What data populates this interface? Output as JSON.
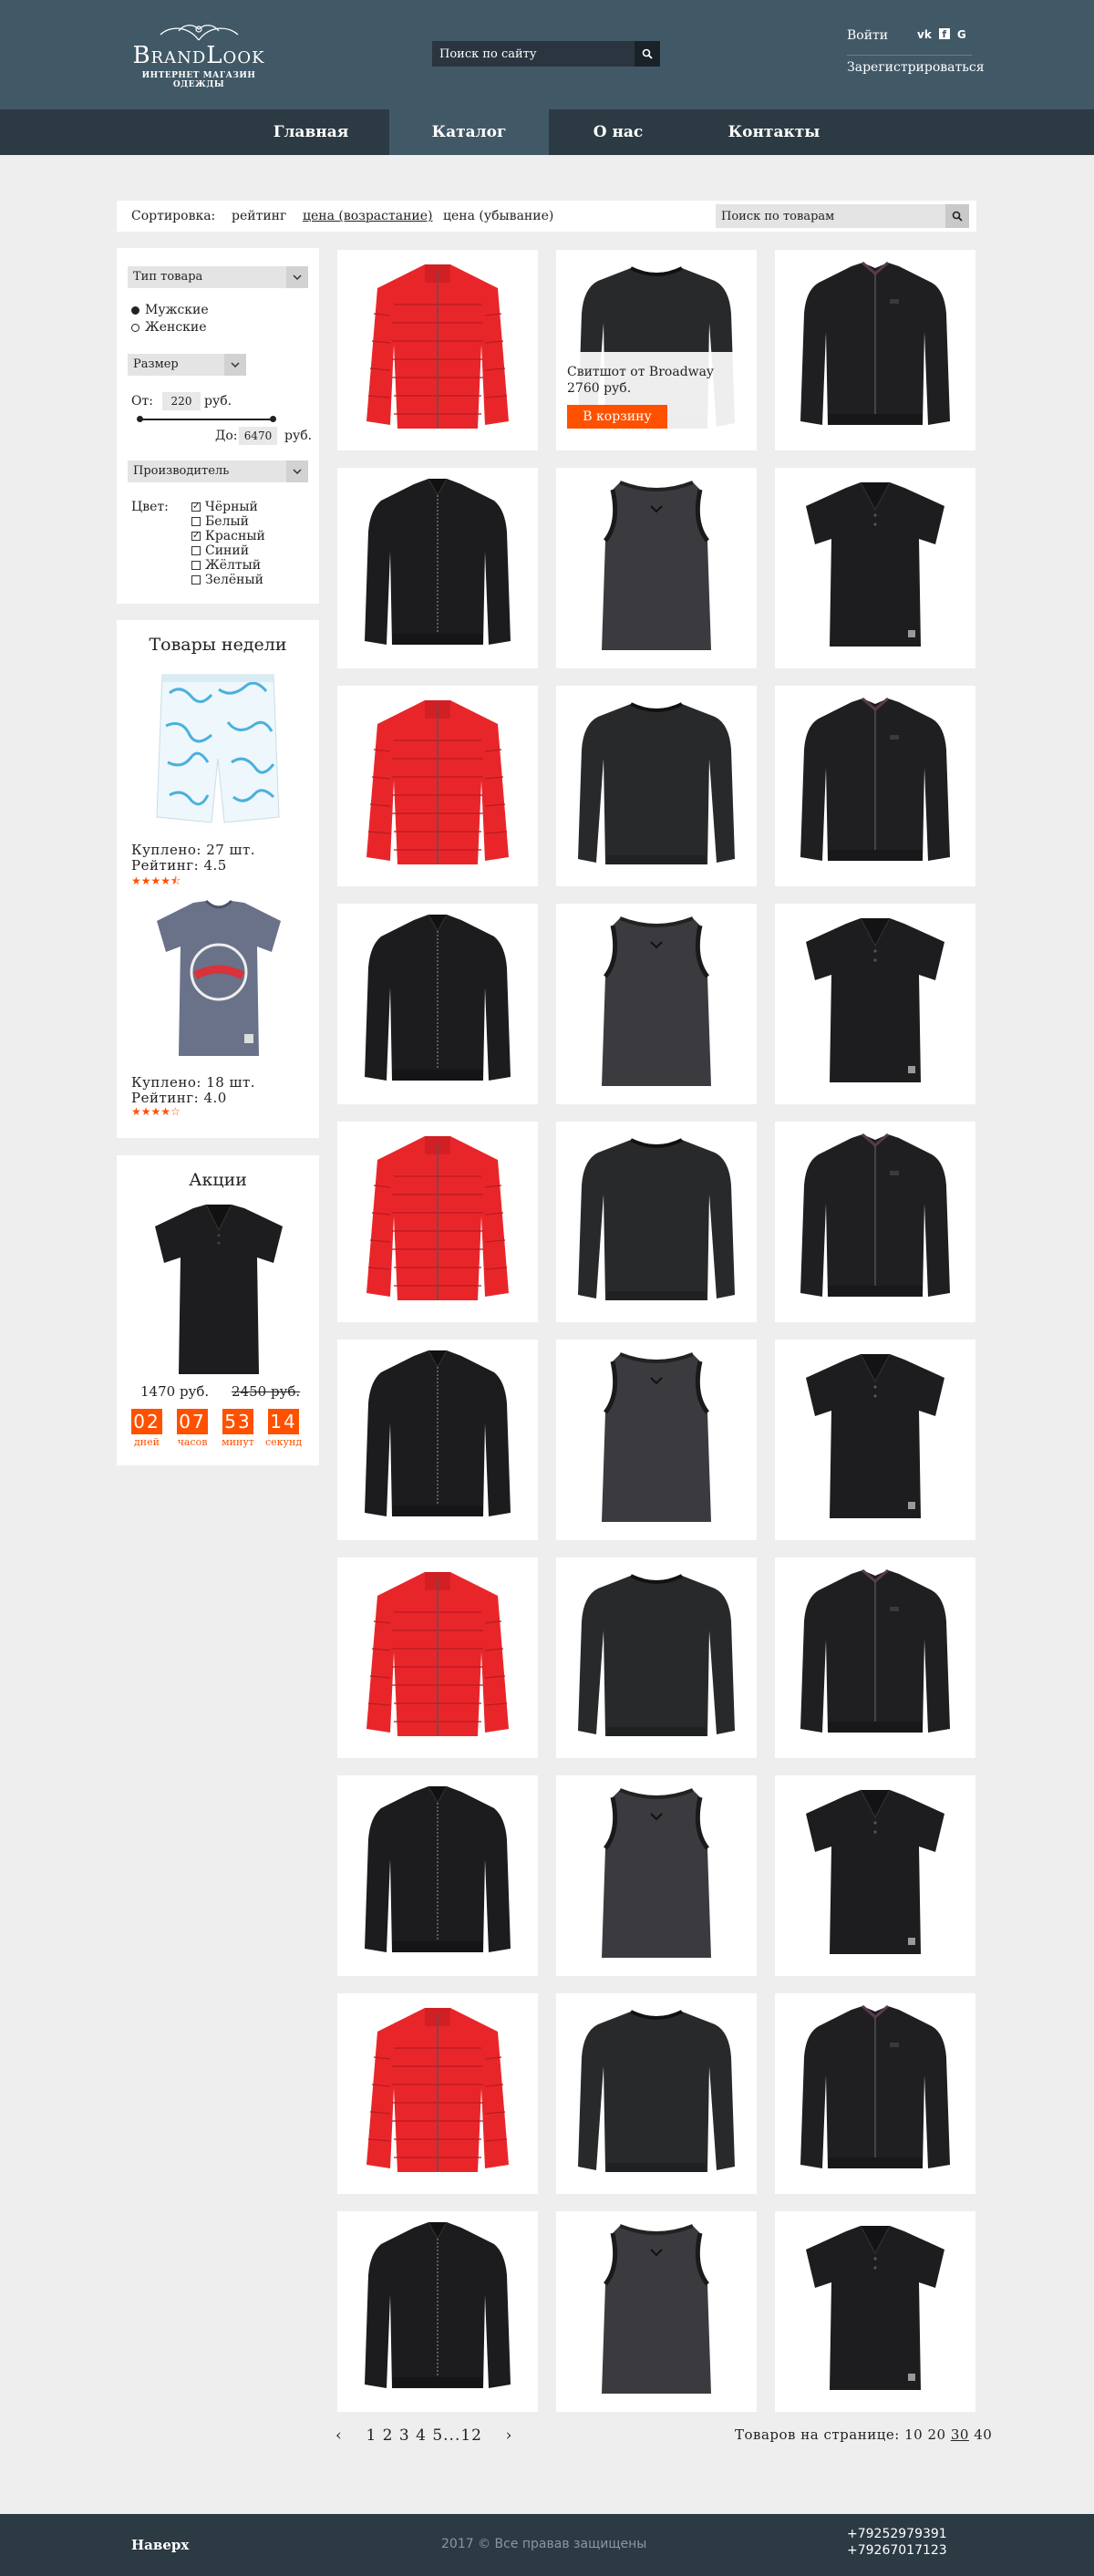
{
  "header": {
    "brand": "BrandLook",
    "tagline": "Интернет магазин одежды",
    "search_placeholder": "Поиск по сайту",
    "login": "Войти",
    "register": "Зарегистрироваться",
    "social_icons": [
      "vk-icon",
      "facebook-icon",
      "google-icon"
    ]
  },
  "nav": {
    "items": [
      {
        "label": "Главная",
        "active": false
      },
      {
        "label": "Каталог",
        "active": true
      },
      {
        "label": "О нас",
        "active": false
      },
      {
        "label": "Контакты",
        "active": false
      }
    ]
  },
  "sortbar": {
    "label": "Сортировка:",
    "options": [
      "рейтинг",
      "цена (возрастание)",
      "цена (убывание)"
    ],
    "active_option": "цена (возрастание)",
    "search_placeholder": "Поиск по товарам"
  },
  "filter": {
    "type_label": "Тип товара",
    "genders": [
      "Мужские",
      "Женские"
    ],
    "selected_gender": "Мужские",
    "size_label": "Размер",
    "from_label": "От:",
    "from_value": "220",
    "to_label": "До:",
    "to_value": "6470",
    "currency": "руб.",
    "maker_label": "Производитель",
    "color_label": "Цвет:",
    "colors": [
      {
        "name": "Чёрный",
        "checked": true
      },
      {
        "name": "Белый",
        "checked": false
      },
      {
        "name": "Красный",
        "checked": true
      },
      {
        "name": "Синий",
        "checked": false
      },
      {
        "name": "Жёлтый",
        "checked": false
      },
      {
        "name": "Зелёный",
        "checked": false
      }
    ]
  },
  "week": {
    "title": "Товары недели",
    "items": [
      {
        "bought": "Куплено: 27 шт.",
        "rating": "Рейтинг: 4.5",
        "stars": 4.5
      },
      {
        "bought": "Куплено: 18 шт.",
        "rating": "Рейтинг: 4.0",
        "stars": 4.0
      }
    ]
  },
  "promo": {
    "title": "Акции",
    "price_new": "1470 руб.",
    "price_old": "2450 руб.",
    "timer": [
      {
        "value": "02",
        "label": "дней"
      },
      {
        "value": "07",
        "label": "часов"
      },
      {
        "value": "53",
        "label": "минут"
      },
      {
        "value": "14",
        "label": "секунд"
      }
    ]
  },
  "hover_card": {
    "name": "Свитшот от Broadway",
    "price": "2760 руб.",
    "button": "В корзину"
  },
  "pager": {
    "prev": "‹",
    "pages": "1 2 3 4 5...12",
    "next": "›",
    "per_page_label": "Товаров на странице:",
    "per_page_options": [
      "10",
      "20",
      "30",
      "40"
    ],
    "per_page_active": "30"
  },
  "footer": {
    "top": "Наверх",
    "copyright": "2017 © Все правав защищены",
    "phones": [
      "+79252979391",
      "+79267017123"
    ]
  },
  "colors": {
    "header_bg": "#415867",
    "nav_bg": "#2c3a44",
    "accent": "#ff5000",
    "jacket_red": "#e8262a"
  }
}
